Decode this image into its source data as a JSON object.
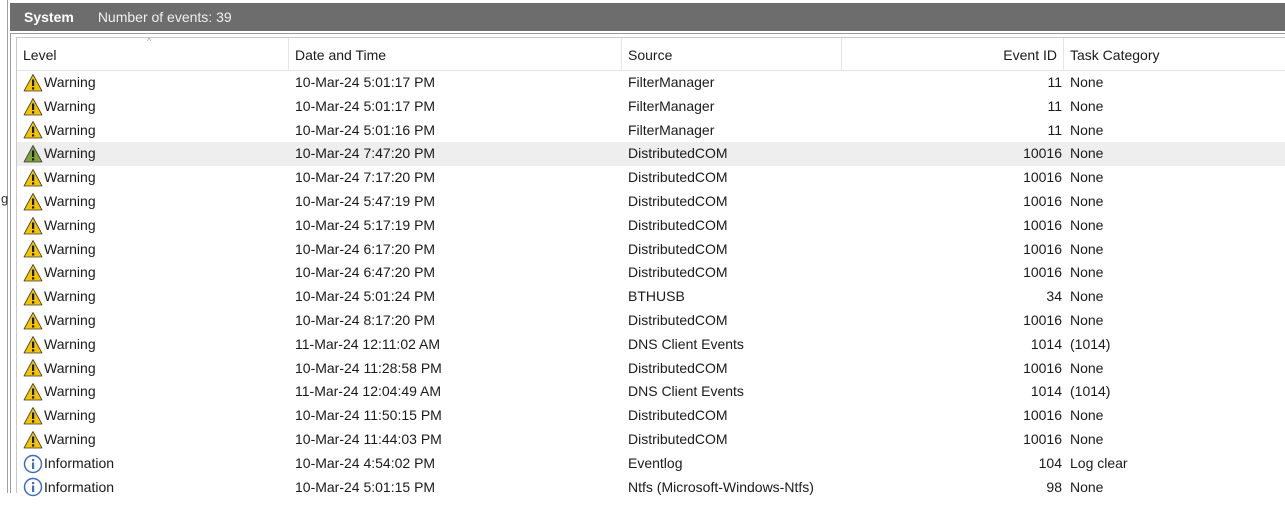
{
  "left_strip": {
    "cut_text": "g"
  },
  "header": {
    "log_name": "System",
    "event_count": "Number of events: 39"
  },
  "columns": [
    "Level",
    "Date and Time",
    "Source",
    "Event ID",
    "Task Category"
  ],
  "sort_indicator": "^",
  "rows": [
    {
      "level": "Warning",
      "icon": "warning-icon",
      "date": "10-Mar-24 5:01:17 PM",
      "source": "FilterManager",
      "id": "11",
      "task": "None"
    },
    {
      "level": "Warning",
      "icon": "warning-icon",
      "date": "10-Mar-24 5:01:17 PM",
      "source": "FilterManager",
      "id": "11",
      "task": "None"
    },
    {
      "level": "Warning",
      "icon": "warning-icon",
      "date": "10-Mar-24 5:01:16 PM",
      "source": "FilterManager",
      "id": "11",
      "task": "None"
    },
    {
      "level": "Warning",
      "icon": "warning-icon",
      "date": "10-Mar-24 7:47:20 PM",
      "source": "DistributedCOM",
      "id": "10016",
      "task": "None",
      "highlighted": true
    },
    {
      "level": "Warning",
      "icon": "warning-icon",
      "date": "10-Mar-24 7:17:20 PM",
      "source": "DistributedCOM",
      "id": "10016",
      "task": "None"
    },
    {
      "level": "Warning",
      "icon": "warning-icon",
      "date": "10-Mar-24 5:47:19 PM",
      "source": "DistributedCOM",
      "id": "10016",
      "task": "None"
    },
    {
      "level": "Warning",
      "icon": "warning-icon",
      "date": "10-Mar-24 5:17:19 PM",
      "source": "DistributedCOM",
      "id": "10016",
      "task": "None"
    },
    {
      "level": "Warning",
      "icon": "warning-icon",
      "date": "10-Mar-24 6:17:20 PM",
      "source": "DistributedCOM",
      "id": "10016",
      "task": "None"
    },
    {
      "level": "Warning",
      "icon": "warning-icon",
      "date": "10-Mar-24 6:47:20 PM",
      "source": "DistributedCOM",
      "id": "10016",
      "task": "None"
    },
    {
      "level": "Warning",
      "icon": "warning-icon",
      "date": "10-Mar-24 5:01:24 PM",
      "source": "BTHUSB",
      "id": "34",
      "task": "None"
    },
    {
      "level": "Warning",
      "icon": "warning-icon",
      "date": "10-Mar-24 8:17:20 PM",
      "source": "DistributedCOM",
      "id": "10016",
      "task": "None"
    },
    {
      "level": "Warning",
      "icon": "warning-icon",
      "date": "11-Mar-24 12:11:02 AM",
      "source": "DNS Client Events",
      "id": "1014",
      "task": "(1014)"
    },
    {
      "level": "Warning",
      "icon": "warning-icon",
      "date": "10-Mar-24 11:28:58 PM",
      "source": "DistributedCOM",
      "id": "10016",
      "task": "None"
    },
    {
      "level": "Warning",
      "icon": "warning-icon",
      "date": "11-Mar-24 12:04:49 AM",
      "source": "DNS Client Events",
      "id": "1014",
      "task": "(1014)"
    },
    {
      "level": "Warning",
      "icon": "warning-icon",
      "date": "10-Mar-24 11:50:15 PM",
      "source": "DistributedCOM",
      "id": "10016",
      "task": "None"
    },
    {
      "level": "Warning",
      "icon": "warning-icon",
      "date": "10-Mar-24 11:44:03 PM",
      "source": "DistributedCOM",
      "id": "10016",
      "task": "None"
    },
    {
      "level": "Information",
      "icon": "info-icon",
      "date": "10-Mar-24 4:54:02 PM",
      "source": "Eventlog",
      "id": "104",
      "task": "Log clear"
    },
    {
      "level": "Information",
      "icon": "info-icon",
      "date": "10-Mar-24 5:01:15 PM",
      "source": "Ntfs (Microsoft-Windows-Ntfs)",
      "id": "98",
      "task": "None"
    }
  ],
  "colors": {
    "titlebar_bg": "#6d6d6d",
    "warning_fill": "#f5c400",
    "warning_fill_highlighted": "#7fa33a",
    "info_ring": "#3c6fb8",
    "row_highlight": "#eeeeee"
  }
}
